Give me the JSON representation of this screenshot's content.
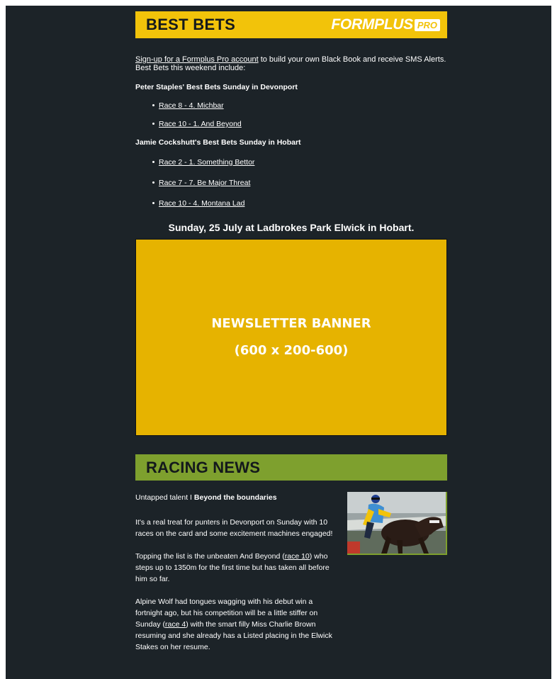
{
  "header": {
    "title": "BEST BETS",
    "logo_main": "FORMPLUS",
    "logo_pro": "PRO"
  },
  "intro": {
    "link_text": "Sign-up for a Formplus Pro account",
    "rest_text": " to build your own Black Book and receive SMS Alerts. Best Bets this weekend include:"
  },
  "tipsters": [
    {
      "heading": "Peter Staples' Best Bets Sunday in Devonport",
      "bets": [
        "Race 8 - 4. Michbar",
        "Race 10 - 1. And Beyond"
      ]
    },
    {
      "heading": "Jamie Cockshutt's Best Bets Sunday in Hobart",
      "bets": [
        "Race 2 - 1. Something Bettor",
        "Race 7 - 7. Be Major Threat",
        "Race 10 - 4. Montana Lad"
      ]
    }
  ],
  "event_line": "Sunday, 25 July at Ladbrokes Park Elwick in Hobart.",
  "banner": {
    "line1": "NEWSLETTER BANNER",
    "line2": "(600 x 200-600)"
  },
  "news": {
    "title": "RACING NEWS",
    "headline_lead": "Untapped talent I ",
    "headline_bold": "Beyond the boundaries",
    "p1": "It's a real treat for punters in Devonport on Sunday with 10 races on the card and some excitement machines engaged!",
    "p2_a": "Topping the list is the unbeaten And Beyond (",
    "p2_link": "race 10",
    "p2_b": ") who steps up to 1350m for the first time but has taken all before him so far.",
    "p3_a": "Alpine Wolf had tongues wagging with his debut win a fortnight ago, but his competition will be a little stiffer on Sunday (",
    "p3_link": "race 4",
    "p3_b": ") with the smart filly Miss Charlie Brown resuming and she already has a Listed placing in the Elwick Stakes on her resume."
  },
  "colors": {
    "background": "#1c2328",
    "best_bets_bar": "#f2c30a",
    "banner": "#e6b300",
    "news_bar": "#7ea02e",
    "headline_green": "#a8d33d"
  }
}
